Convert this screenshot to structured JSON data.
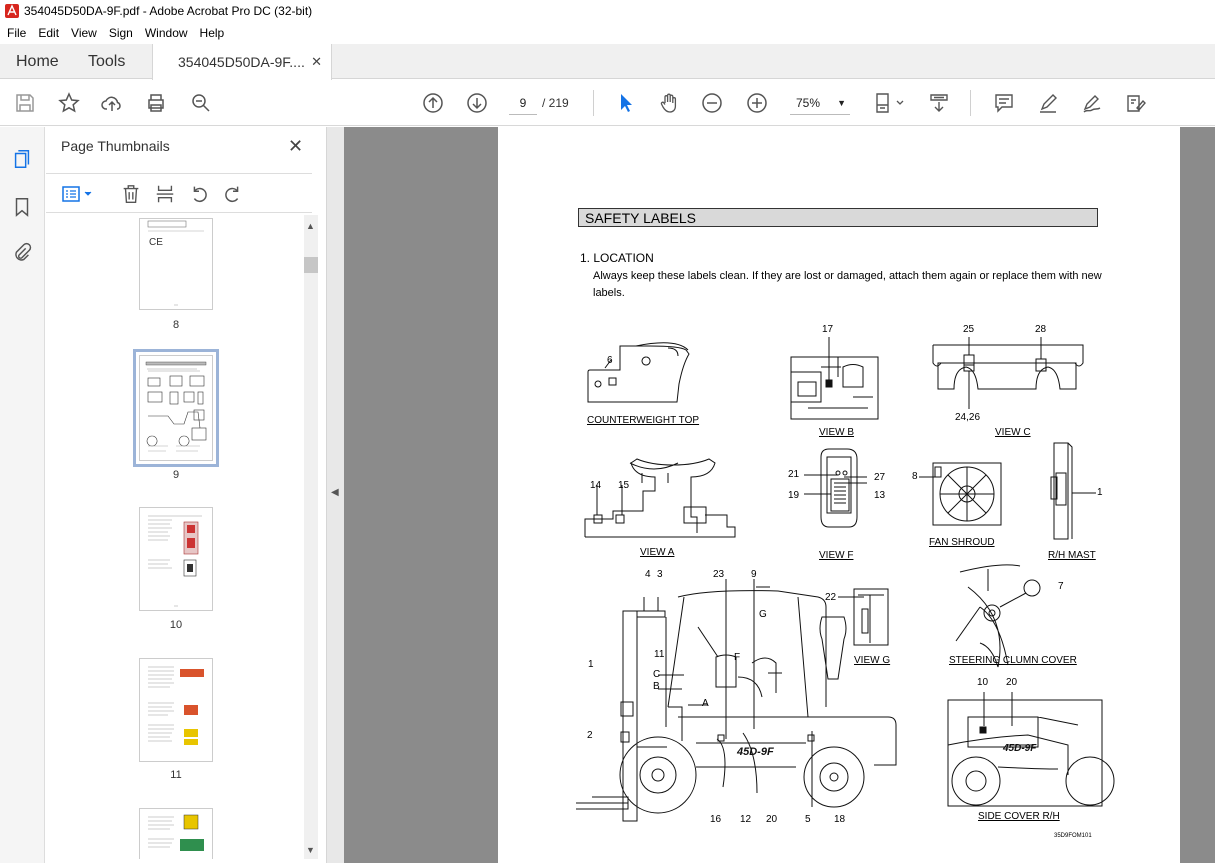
{
  "window": {
    "title": "354045D50DA-9F.pdf - Adobe Acrobat Pro DC (32-bit)"
  },
  "menu": [
    "File",
    "Edit",
    "View",
    "Sign",
    "Window",
    "Help"
  ],
  "tabs": {
    "home": "Home",
    "tools": "Tools",
    "doc": "354045D50DA-9F....",
    "doc_close": "✕"
  },
  "toolbar": {
    "page_current": "9",
    "page_total": "/  219",
    "zoom": "75%"
  },
  "panel": {
    "title": "Page Thumbnails",
    "thumbs": [
      {
        "label": "8"
      },
      {
        "label": "9"
      },
      {
        "label": "10"
      },
      {
        "label": "11"
      }
    ]
  },
  "page": {
    "section_title": "SAFETY LABELS",
    "location_heading": "1. LOCATION",
    "location_text": "Always keep these labels clean.  If they are lost or damaged, attach them again or replace them with new labels.",
    "figure_labels": {
      "counterweight_top": "COUNTERWEIGHT TOP",
      "view_b": "VIEW B",
      "view_c": "VIEW C",
      "view_a": "VIEW A",
      "view_f": "VIEW F",
      "fan_shroud": "FAN SHROUD",
      "rh_mast": "R/H MAST",
      "view_g": "VIEW G",
      "steering_cover": "STEERING CLUMN COVER",
      "side_cover": "SIDE COVER R/H"
    },
    "callouts": {
      "n6": "6",
      "n17": "17",
      "n25": "25",
      "n28": "28",
      "n2426": "24,26",
      "n14": "14",
      "n15": "15",
      "n21": "21",
      "n27": "27",
      "n19": "19",
      "n13": "13",
      "n8": "8",
      "n1a": "1",
      "n4": "4",
      "n3": "3",
      "n23": "23",
      "n9": "9",
      "n22": "22",
      "n7": "7",
      "n11": "11",
      "g": "G",
      "c": "C",
      "b": "B",
      "f": "F",
      "a": "A",
      "n1b": "1",
      "n2": "2",
      "n16": "16",
      "n12": "12",
      "n20a": "20",
      "n5": "5",
      "n18": "18",
      "n10": "10",
      "n20b": "20"
    },
    "model_mark": "45D-9F",
    "page_code": "35D9FOM101"
  }
}
